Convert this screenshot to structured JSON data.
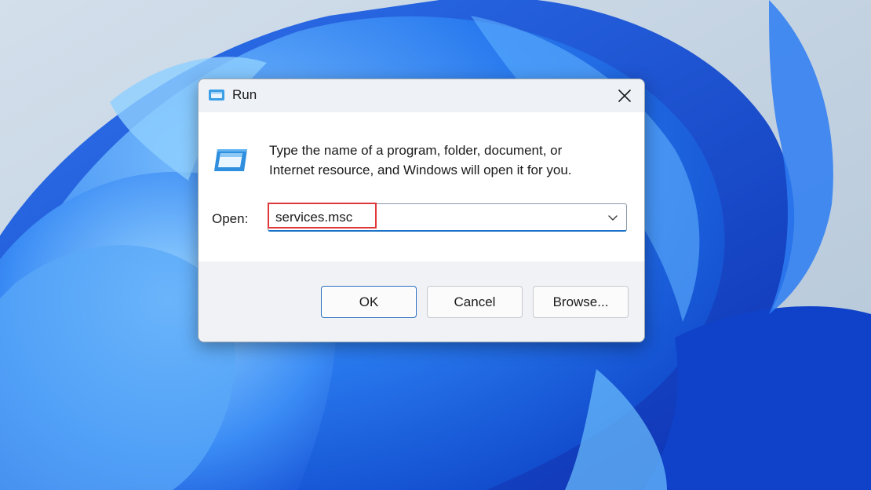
{
  "dialog": {
    "title": "Run",
    "description_line1": "Type the name of a program, folder, document, or",
    "description_line2": "Internet resource, and Windows will open it for you.",
    "open_label": "Open:",
    "open_value": "services.msc",
    "buttons": {
      "ok": "OK",
      "cancel": "Cancel",
      "browse": "Browse..."
    }
  },
  "icons": {
    "title": "run-app-icon",
    "close": "close-icon",
    "dialog": "run-app-icon",
    "dropdown": "chevron-down-icon"
  },
  "colors": {
    "accent": "#1a73c8",
    "highlight": "#e0383a",
    "wallpaper": "#1e63e6"
  }
}
